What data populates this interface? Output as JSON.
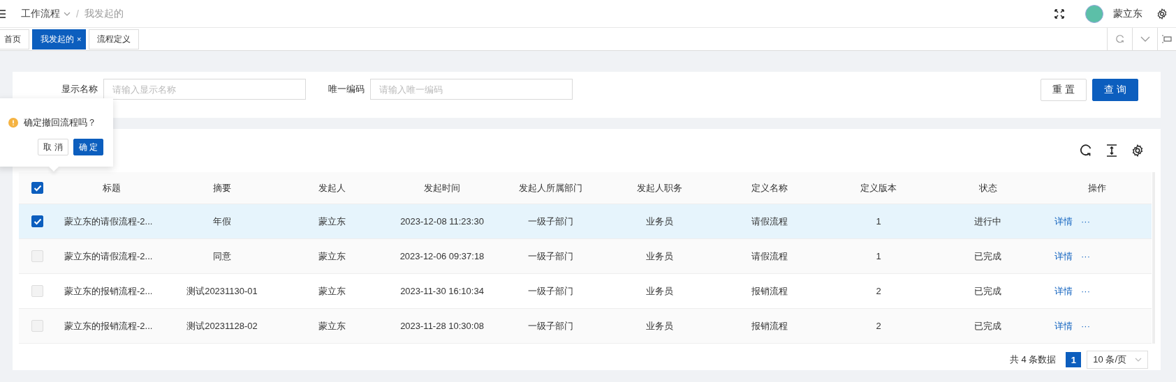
{
  "topbar": {
    "breadcrumb": [
      {
        "label": "工作流程",
        "dropdown": true
      },
      {
        "label": "我发起的",
        "dropdown": false
      }
    ],
    "user": {
      "name": "蒙立东"
    }
  },
  "tabs": [
    {
      "label": "首页",
      "selected": false,
      "closable": false
    },
    {
      "label": "我发起的",
      "selected": true,
      "closable": true
    },
    {
      "label": "流程定义",
      "selected": false,
      "closable": false
    }
  ],
  "tab_close": "×",
  "breadcrumb_separator": "/",
  "search": {
    "fields": [
      {
        "label": "显示名称",
        "placeholder": "请输入显示名称"
      },
      {
        "label": "唯一编码",
        "placeholder": "请输入唯一编码"
      }
    ],
    "buttons": [
      {
        "label": "重 置",
        "kind": "default"
      },
      {
        "label": "查 询",
        "kind": "primary"
      }
    ]
  },
  "popconfirm": {
    "message": "确定撤回流程吗？",
    "buttons": [
      {
        "label": "取 消",
        "kind": "default"
      },
      {
        "label": "确 定",
        "kind": "primary"
      }
    ]
  },
  "table": {
    "all_checked": true,
    "columns": [
      "标题",
      "摘要",
      "发起人",
      "发起时间",
      "发起人所属部门",
      "发起人职务",
      "定义名称",
      "定义版本",
      "状态",
      "操作"
    ],
    "rows": [
      {
        "selected": true,
        "cells": [
          "蒙立东的请假流程-2...",
          "年假",
          "蒙立东",
          "2023-12-08 11:23:30",
          "一级子部门",
          "业务员",
          "请假流程",
          "1",
          "进行中"
        ],
        "link": "详情",
        "more": "···"
      },
      {
        "selected": false,
        "cells": [
          "蒙立东的请假流程-2...",
          "同意",
          "蒙立东",
          "2023-12-06 09:37:18",
          "一级子部门",
          "业务员",
          "请假流程",
          "1",
          "已完成"
        ],
        "link": "详情",
        "more": "···"
      },
      {
        "selected": false,
        "cells": [
          "蒙立东的报销流程-2...",
          "测试20231130-01",
          "蒙立东",
          "2023-11-30 16:10:34",
          "一级子部门",
          "业务员",
          "报销流程",
          "2",
          "已完成"
        ],
        "link": "详情",
        "more": "···"
      },
      {
        "selected": false,
        "cells": [
          "蒙立东的报销流程-2...",
          "测试20231128-02",
          "蒙立东",
          "2023-11-28 10:30:08",
          "一级子部门",
          "业务员",
          "报销流程",
          "2",
          "已完成"
        ],
        "link": "详情",
        "more": "···"
      }
    ]
  },
  "pagination": {
    "total": "共 4 条数据",
    "pages": [
      {
        "label": "1",
        "selected": true
      }
    ],
    "page_size": "10 条/页"
  }
}
